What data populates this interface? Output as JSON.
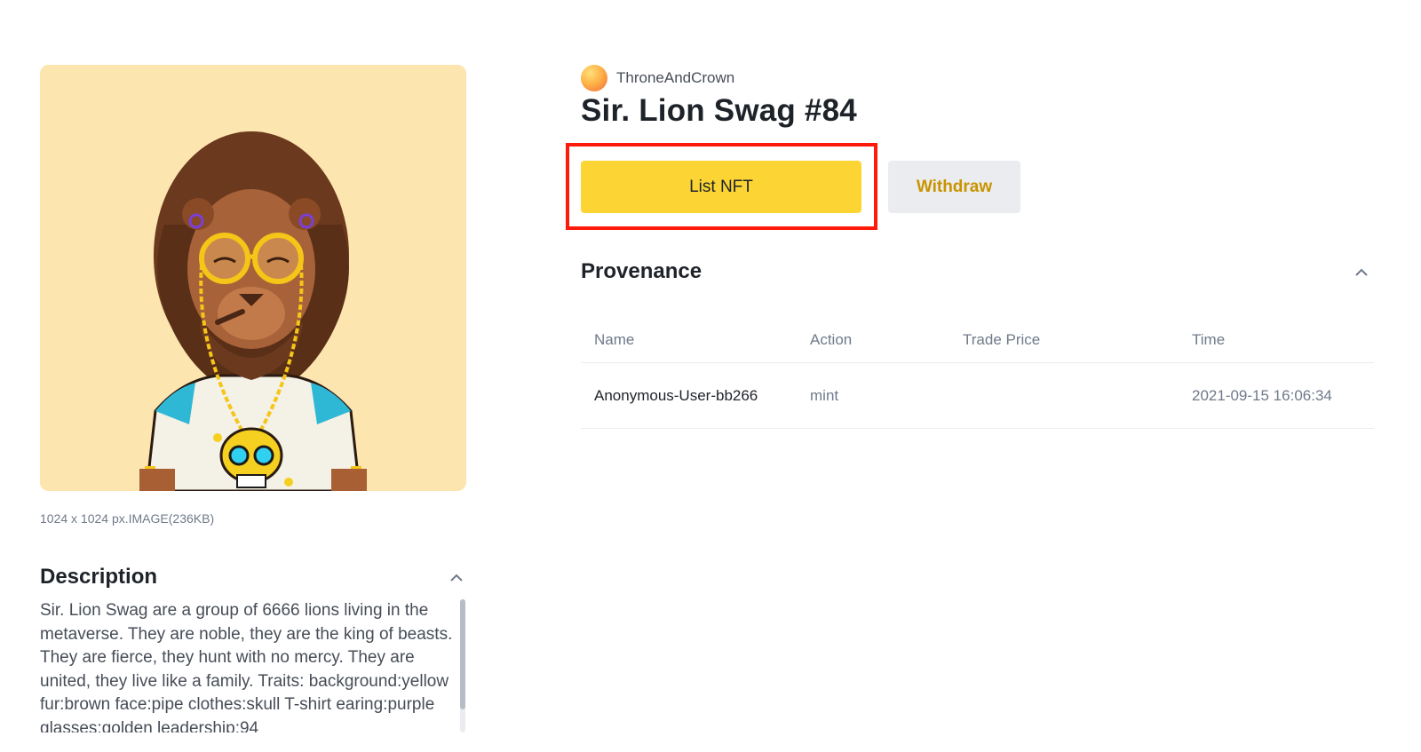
{
  "artwork": {
    "icon": "lion-nft-artwork",
    "background": "#fde5b0",
    "meta": "1024 x 1024 px.IMAGE(236KB)"
  },
  "description": {
    "title": "Description",
    "text": "Sir. Lion Swag are a group of 6666 lions living in the metaverse. They are noble, they are the king of beasts. They are fierce, they hunt with no mercy. They are united, they live like a family. Traits: background:yellow fur:brown face:pipe clothes:skull T-shirt earing:purple glasses:golden leadership:94"
  },
  "creator": {
    "name": "ThroneAndCrown"
  },
  "nft": {
    "title": "Sir. Lion Swag #84"
  },
  "actions": {
    "list_label": "List NFT",
    "withdraw_label": "Withdraw"
  },
  "provenance": {
    "title": "Provenance",
    "columns": {
      "name": "Name",
      "action": "Action",
      "price": "Trade Price",
      "time": "Time"
    },
    "rows": [
      {
        "name": "Anonymous-User-bb266",
        "action": "mint",
        "price": "",
        "time": "2021-09-15 16:06:34"
      }
    ]
  },
  "colors": {
    "accent": "#fcd535",
    "withdraw_text": "#c99400",
    "highlight": "#ff1a0a"
  }
}
